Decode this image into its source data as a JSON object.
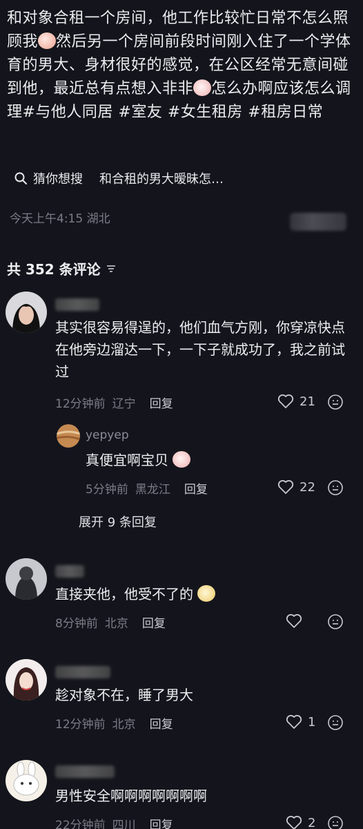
{
  "post": {
    "text_part1": "和对象合租一个房间，他工作比较忙日常不怎么照顾我",
    "text_part2": "然后另一个房间前段时间刚入住了一个学体育的男大、身材很好的感觉，在公区经常无意间碰到他，最近总有点想入非非",
    "text_part3": "怎么办啊应该怎么调理#与他人同居 #室友 #女生租房 #租房日常",
    "emoji1": "sob-face-icon",
    "emoji2": "blush-face-icon"
  },
  "suggestion": {
    "prefix": "猜你想搜",
    "query": "和合租的男大暧昧怎…"
  },
  "post_meta": "今天上午4:15 湖北",
  "comments_header": {
    "label": "共 352 条评论"
  },
  "comments": [
    {
      "text": "其实很容易得逞的，他们血气方刚，你穿凉快点在他旁边溜达一下，一下子就成功了，我之前试过",
      "time": "12分钟前",
      "location": "辽宁",
      "reply_label": "回复",
      "likes": "21"
    },
    {
      "username": "yepyep",
      "text": "真便宜啊宝贝",
      "time": "5分钟前",
      "location": "黑龙江",
      "reply_label": "回复",
      "likes": "22"
    },
    {
      "text": "直接夹他，他受不了的",
      "time": "8分钟前",
      "location": "北京",
      "reply_label": "回复",
      "likes": ""
    },
    {
      "text": "趁对象不在，睡了男大",
      "time": "12分钟前",
      "location": "北京",
      "reply_label": "回复",
      "likes": "1"
    },
    {
      "text": "男性安全啊啊啊啊啊啊啊",
      "time": "22分钟前",
      "location": "四川",
      "reply_label": "回复",
      "likes": "2"
    }
  ],
  "expand_replies": "展开 9 条回复",
  "colors": {
    "background": "#14151c",
    "text": "#ececf0",
    "muted": "#7b7c86"
  }
}
